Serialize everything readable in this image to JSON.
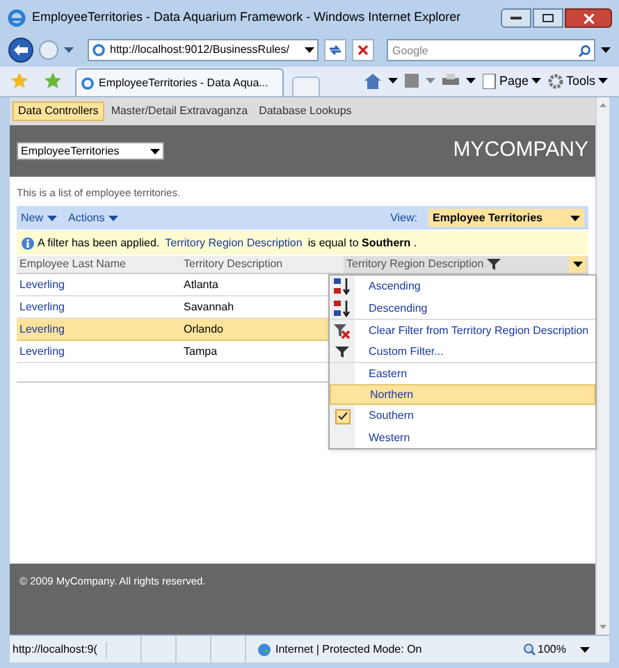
{
  "window": {
    "title": "EmployeeTerritories - Data Aquarium Framework - Windows Internet Explorer"
  },
  "navigation": {
    "address": "http://localhost:9012/BusinessRules/",
    "search_placeholder": "Google"
  },
  "browser_tab": {
    "title": "EmployeeTerritories - Data Aqua..."
  },
  "commands": [
    "Page",
    "Tools"
  ],
  "menu_tabs": [
    {
      "label": "Data Controllers",
      "selected": true
    },
    {
      "label": "Master/Detail Extravaganza",
      "selected": false
    },
    {
      "label": "Database Lookups",
      "selected": false
    }
  ],
  "header": {
    "controller": "EmployeeTerritories",
    "company": "MYCOMPANY"
  },
  "description": "This is a list of employee territories.",
  "action_bar": {
    "items": [
      "New",
      "Actions"
    ],
    "view_label": "View:",
    "view": "Employee Territories"
  },
  "filter_notice": {
    "text": "A filter has been applied.",
    "link": "Territory Region Description",
    "rest": "is equal to **Southern** ."
  },
  "grid": {
    "columns": [
      "Employee Last Name",
      "Territory Description",
      "Territory Region Description"
    ],
    "rows": [
      {
        "cells": [
          "Leverling",
          "Atlanta"
        ],
        "selected": false
      },
      {
        "cells": [
          "Leverling",
          "Savannah"
        ],
        "selected": false
      },
      {
        "cells": [
          "Leverling",
          "Orlando"
        ],
        "selected": true
      },
      {
        "cells": [
          "Leverling",
          "Tampa"
        ],
        "selected": false
      }
    ]
  },
  "column_menu": [
    {
      "kind": "sort-asc",
      "label": "Ascending",
      "selected": false,
      "checked": false
    },
    {
      "kind": "sort-desc",
      "label": "Descending",
      "selected": false,
      "checked": false
    },
    {
      "kind": "clear",
      "label": "Clear Filter from Territory Region Description",
      "selected": false,
      "checked": false
    },
    {
      "kind": "filter",
      "label": "Custom Filter...",
      "selected": false,
      "checked": false
    },
    {
      "kind": "value",
      "label": "Eastern",
      "selected": false,
      "checked": false
    },
    {
      "kind": "value",
      "label": "Northern",
      "selected": true,
      "checked": false
    },
    {
      "kind": "value",
      "label": "Southern",
      "selected": false,
      "checked": true
    },
    {
      "kind": "value",
      "label": "Western",
      "selected": false,
      "checked": false
    }
  ],
  "footer": "© 2009 MyCompany. All rights reserved.",
  "status_bar": {
    "url": "http://localhost:9(",
    "zone": "Internet | Protected Mode: On",
    "zoom": "100%"
  }
}
